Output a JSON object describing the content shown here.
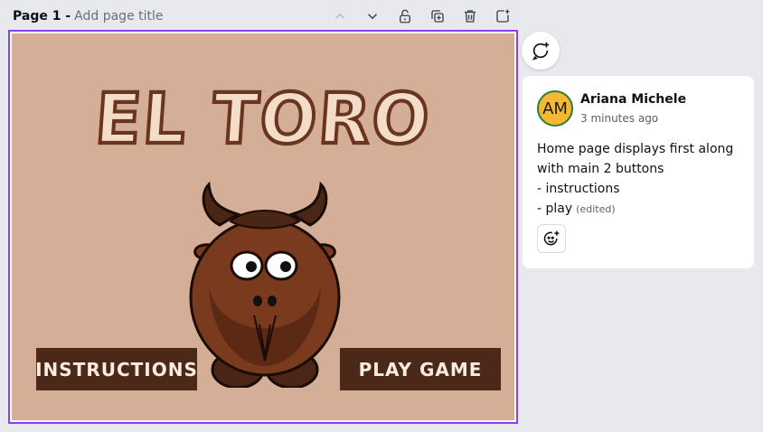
{
  "page_header": {
    "page_label": "Page 1 -",
    "title_placeholder": "Add page title"
  },
  "toolbar": {
    "icons": [
      "chevron-up-icon",
      "chevron-down-icon",
      "lock-icon",
      "duplicate-icon",
      "trash-icon",
      "add-page-icon"
    ]
  },
  "canvas": {
    "game_title": "EL TORO",
    "instructions_button": "INSTRUCTIONS",
    "play_button": "PLAY GAME"
  },
  "comment": {
    "avatar_initials": "AM",
    "author": "Ariana Michele",
    "time": "3 minutes ago",
    "lines": [
      "Home page displays first along",
      "with main 2 buttons",
      "- instructions",
      "- play"
    ],
    "edited_label": "(edited)"
  },
  "colors": {
    "selection": "#8b3dff",
    "canvas_bg": "#d4ae96",
    "button_bg": "#4b2818",
    "avatar_bg": "#f5b833"
  }
}
